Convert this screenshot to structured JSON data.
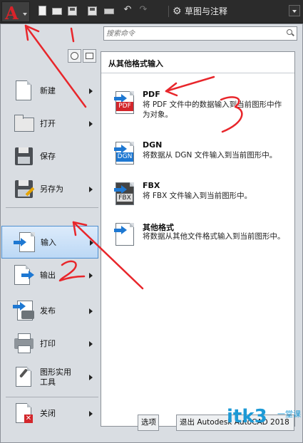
{
  "quick_access": {
    "workspace_label": "草图与注释",
    "icons": [
      "new-icon",
      "open-icon",
      "save-icon",
      "save-as-icon",
      "print-icon",
      "undo-icon",
      "redo-icon"
    ]
  },
  "search": {
    "placeholder": "搜索命令"
  },
  "menu": {
    "items": [
      {
        "label": "新建",
        "has_submenu": true
      },
      {
        "label": "打开",
        "has_submenu": true
      },
      {
        "label": "保存",
        "has_submenu": false
      },
      {
        "label": "另存为",
        "has_submenu": true
      },
      {
        "label": "输入",
        "has_submenu": true,
        "active": true
      },
      {
        "label": "输出",
        "has_submenu": true
      },
      {
        "label": "发布",
        "has_submenu": true
      },
      {
        "label": "打印",
        "has_submenu": true
      },
      {
        "label": "图形实用\n工具",
        "has_submenu": true
      },
      {
        "label": "关闭",
        "has_submenu": true
      }
    ]
  },
  "flyout": {
    "title": "从其他格式输入",
    "options": [
      {
        "name": "PDF",
        "tag": "PDF",
        "desc": "将 PDF 文件中的数据输入到当前图形中作为对象。"
      },
      {
        "name": "DGN",
        "tag": "DGN",
        "desc": "将数据从 DGN 文件输入到当前图形中。"
      },
      {
        "name": "FBX",
        "tag": "FBX",
        "desc": "将 FBX 文件输入到当前图形中。"
      },
      {
        "name": "其他格式",
        "tag": "",
        "desc": "将数据从其他文件格式输入到当前图形中。"
      }
    ]
  },
  "bottom": {
    "options_label": "选项",
    "exit_label": "退出 Autodesk AutoCAD 2018"
  },
  "watermark": {
    "text": "itk3",
    "sub": "一堂课"
  },
  "colors": {
    "accent_red": "#d8232a",
    "active_blue": "#4d8fd0",
    "annotation_red": "#e8262b",
    "watermark_blue": "#1d9ad6"
  }
}
